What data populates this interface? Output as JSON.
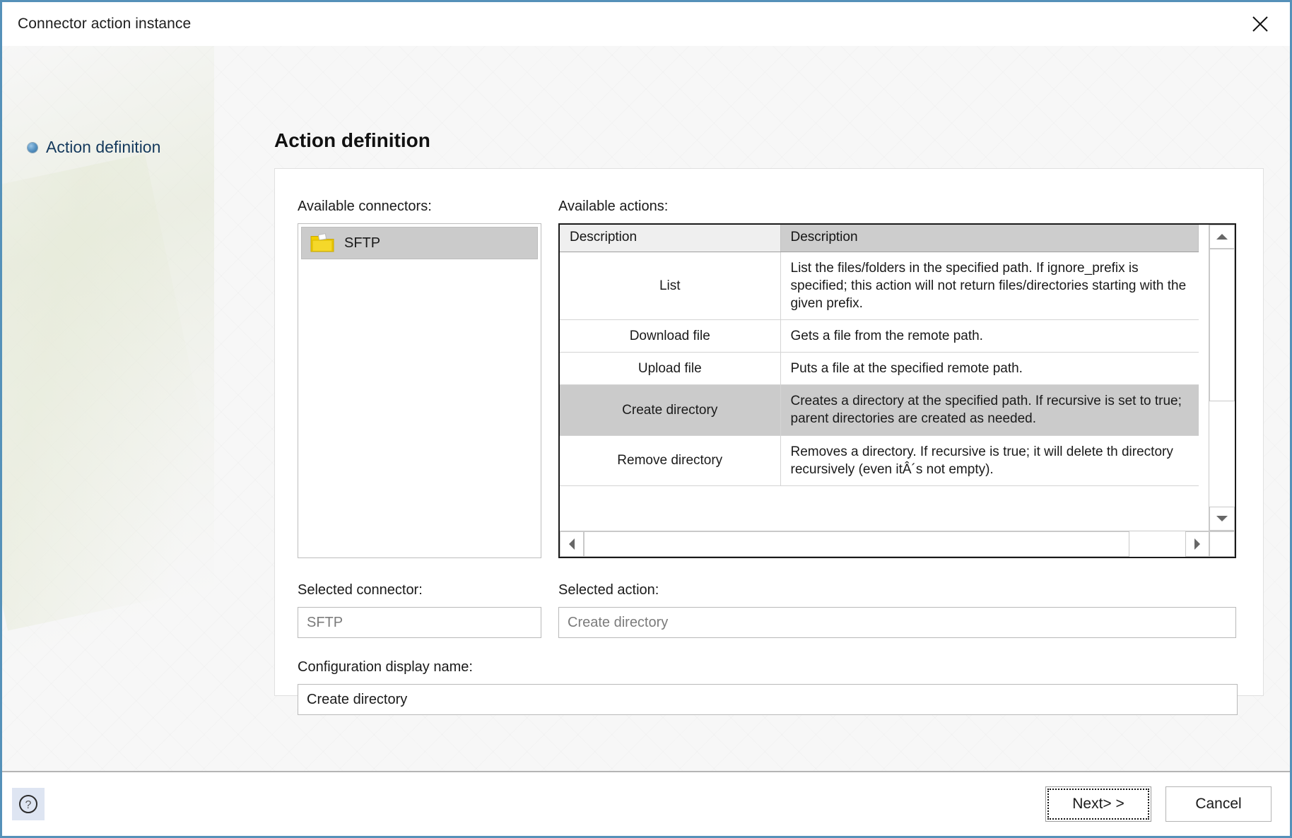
{
  "window": {
    "title": "Connector action instance",
    "close_icon": "close-icon"
  },
  "nav": {
    "items": [
      {
        "label": "Action definition",
        "bullet_icon": "bullet-icon"
      }
    ]
  },
  "page": {
    "title": "Action definition"
  },
  "connectors": {
    "label": "Available connectors:",
    "items": [
      {
        "label": "SFTP",
        "icon": "folder-icon",
        "selected": true
      }
    ]
  },
  "actions": {
    "label": "Available actions:",
    "columns": [
      "Description",
      "Description"
    ],
    "rows": [
      {
        "name": "List",
        "description": "List the files/folders in the specified path. If ignore_prefix is specified; this action will not return files/directories starting with the given prefix.",
        "selected": false
      },
      {
        "name": "Download file",
        "description": "Gets a file from the remote path.",
        "selected": false
      },
      {
        "name": "Upload file",
        "description": "Puts a file at the specified remote path.",
        "selected": false
      },
      {
        "name": "Create directory",
        "description": "Creates a directory at the specified path. If recursive is set to true; parent directories are created as needed.",
        "selected": true
      },
      {
        "name": "Remove directory",
        "description": "Removes a directory. If recursive is true; it will delete th directory recursively (even itÂ´s not empty).",
        "selected": false
      }
    ],
    "scroll": {
      "up_icon": "scroll-up-arrow-icon",
      "down_icon": "scroll-down-arrow-icon",
      "left_icon": "scroll-left-arrow-icon",
      "right_icon": "scroll-right-arrow-icon"
    }
  },
  "selected_connector": {
    "label": "Selected connector:",
    "value": "SFTP"
  },
  "selected_action": {
    "label": "Selected action:",
    "value": "Create directory"
  },
  "config_display_name": {
    "label": "Configuration display name:",
    "value": "Create directory"
  },
  "footer": {
    "help_icon": "help-icon",
    "next_label": "Next> >",
    "cancel_label": "Cancel"
  },
  "colors": {
    "window_border": "#5591b9",
    "selection": "#cbcbcb",
    "nav_text": "#14395c",
    "folder": "#f2ce00",
    "help_bg": "#dee5f2"
  }
}
